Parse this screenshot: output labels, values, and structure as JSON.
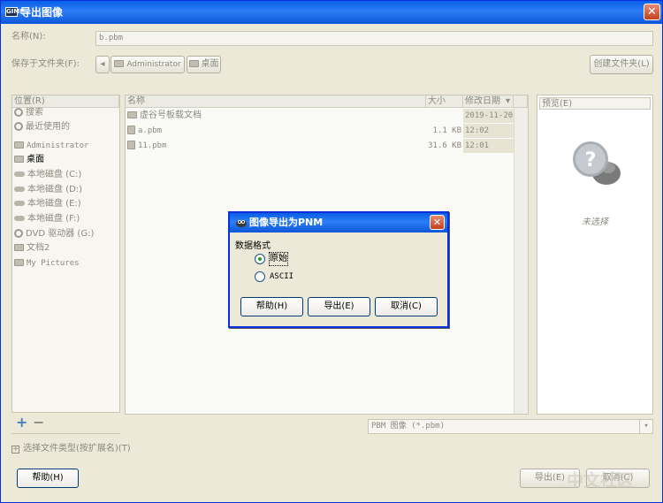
{
  "window": {
    "title": "导出图像",
    "icon_text": "GIMP",
    "close_glyph": "✕"
  },
  "name_row": {
    "label": "名称(N):",
    "value": "b.pbm"
  },
  "folder_row": {
    "label": "保存于文件夹(F):",
    "nav_glyph": "◂",
    "crumbs": [
      "Administrator",
      "桌面"
    ],
    "create_folder_label": "创建文件夹(L)"
  },
  "places": {
    "header": "位置(R)",
    "items": [
      {
        "label": "搜索",
        "icon": "search-icon"
      },
      {
        "label": "最近使用的",
        "icon": "recent-icon"
      },
      {
        "label": "Administrator",
        "icon": "folder-icon"
      },
      {
        "label": "桌面",
        "icon": "folder-icon"
      },
      {
        "label": "本地磁盘 (C:)",
        "icon": "drive-icon"
      },
      {
        "label": "本地磁盘 (D:)",
        "icon": "drive-icon"
      },
      {
        "label": "本地磁盘 (E:)",
        "icon": "drive-icon"
      },
      {
        "label": "本地磁盘 (F:)",
        "icon": "drive-icon"
      },
      {
        "label": "DVD 驱动器 (G:)",
        "icon": "dvd-icon"
      },
      {
        "label": "文档2",
        "icon": "folder-icon"
      },
      {
        "label": "My Pictures",
        "icon": "folder-icon"
      }
    ],
    "add_glyph": "+",
    "remove_glyph": "−"
  },
  "files": {
    "columns": {
      "name": "名称",
      "size": "大小",
      "date": "修改日期"
    },
    "sort_glyph": "▾",
    "rows": [
      {
        "name": "虚谷号板载文档",
        "size": "",
        "date": "2019-11-20",
        "icon": "folder-icon"
      },
      {
        "name": "a.pbm",
        "size": "1.1 KB",
        "date": "12:02",
        "icon": "file-icon"
      },
      {
        "name": "11.pbm",
        "size": "31.6 KB",
        "date": "12:01",
        "icon": "file-icon"
      }
    ]
  },
  "preview": {
    "header": "预览(E)",
    "empty_text": "未选择"
  },
  "filetype_select": {
    "value": "PBM 图像 (*.pbm)",
    "arrow_glyph": "▾"
  },
  "expander": {
    "label": "选择文件类型(按扩展名)(T)",
    "glyph": "+"
  },
  "bottom": {
    "help_label": "帮助(H)",
    "export_label": "导出(E)",
    "cancel_label": "取消(C)"
  },
  "modal": {
    "title": "图像导出为PNM",
    "section_label": "数据格式",
    "options": [
      {
        "label": "原始",
        "selected": true
      },
      {
        "label": "ASCII",
        "selected": false
      }
    ],
    "help_label": "帮助(H)",
    "export_label": "导出(E)",
    "cancel_label": "取消(C)",
    "close_glyph": "✕"
  },
  "watermark": {
    "text": "中文社区"
  }
}
